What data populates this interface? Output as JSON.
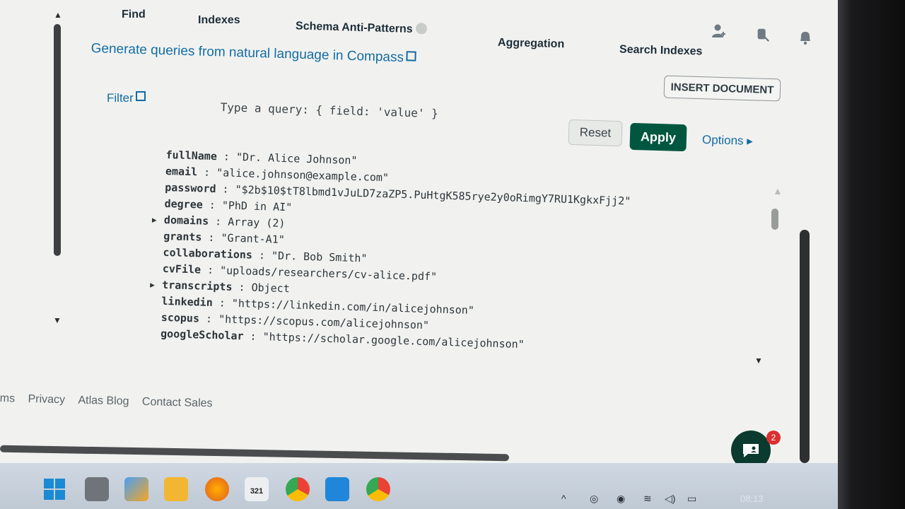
{
  "tabs": {
    "find": "Find",
    "indexes": "Indexes",
    "schema": "Schema Anti-Patterns",
    "aggregation": "Aggregation",
    "search": "Search Indexes"
  },
  "nl_link": "Generate queries from natural language in Compass",
  "insert_button": "INSERT DOCUMENT",
  "filter_label": "Filter",
  "query_placeholder": "Type a query: { field: 'value' }",
  "buttons": {
    "reset": "Reset",
    "apply": "Apply",
    "options": "Options ▸"
  },
  "document": [
    {
      "key": "fullName",
      "value": "\"Dr. Alice Johnson\"",
      "expandable": false
    },
    {
      "key": "email",
      "value": "\"alice.johnson@example.com\"",
      "expandable": false
    },
    {
      "key": "password",
      "value": "\"$2b$10$tT8lbmd1vJuLD7zaZP5.PuHtgK585rye2y0oRimgY7RU1KgkxFjj2\"",
      "expandable": false
    },
    {
      "key": "degree",
      "value": "\"PhD in AI\"",
      "expandable": false
    },
    {
      "key": "domains",
      "value": "Array (2)",
      "expandable": true
    },
    {
      "key": "grants",
      "value": "\"Grant-A1\"",
      "expandable": false
    },
    {
      "key": "collaborations",
      "value": "\"Dr. Bob Smith\"",
      "expandable": false
    },
    {
      "key": "cvFile",
      "value": "\"uploads/researchers/cv-alice.pdf\"",
      "expandable": false
    },
    {
      "key": "transcripts",
      "value": "Object",
      "expandable": true
    },
    {
      "key": "linkedin",
      "value": "\"https://linkedin.com/in/alicejohnson\"",
      "expandable": false
    },
    {
      "key": "scopus",
      "value": "\"https://scopus.com/alicejohnson\"",
      "expandable": false
    },
    {
      "key": "googleScholar",
      "value": "\"https://scholar.google.com/alicejohnson\"",
      "expandable": false
    }
  ],
  "footer": [
    "ms",
    "Privacy",
    "Atlas Blog",
    "Contact Sales"
  ],
  "chat_badge": "2",
  "clock": "08:13",
  "taskbar_calendar": "321",
  "colors": {
    "link": "#126ba3",
    "apply_bg": "#00563f",
    "chat_bg": "#0b3a2e",
    "badge": "#db3030"
  }
}
